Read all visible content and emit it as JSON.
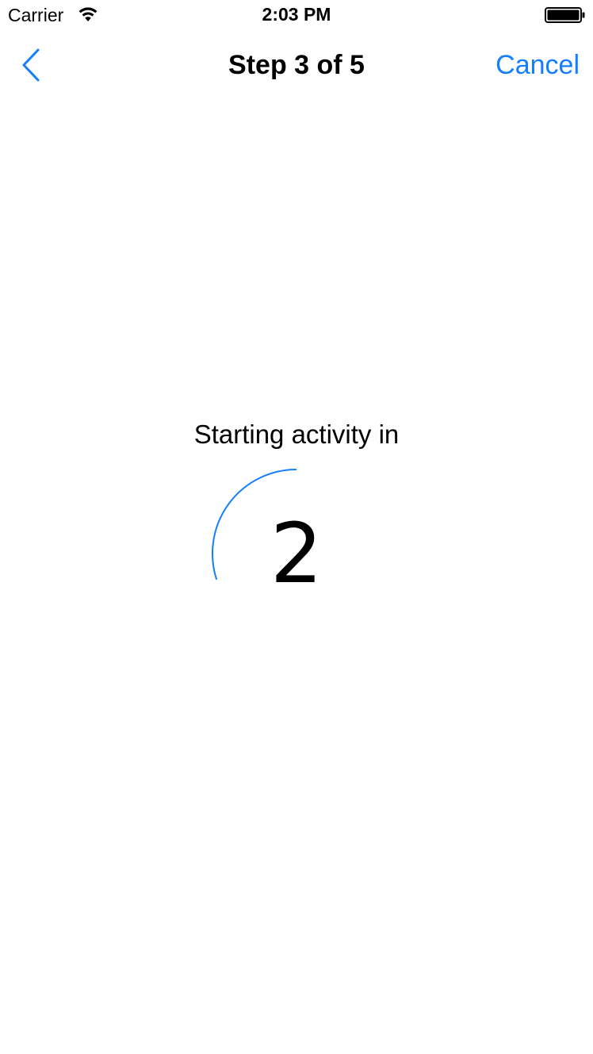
{
  "status_bar": {
    "carrier": "Carrier",
    "time": "2:03 PM",
    "wifi_icon": "wifi-icon",
    "battery_icon": "battery-icon"
  },
  "nav_bar": {
    "back_icon": "chevron-left-icon",
    "title": "Step 3 of 5",
    "cancel_label": "Cancel"
  },
  "countdown": {
    "caption": "Starting activity in",
    "value": "2",
    "progress_fraction": 0.3
  },
  "colors": {
    "accent": "#147efb",
    "text": "#000000",
    "background": "#ffffff"
  }
}
